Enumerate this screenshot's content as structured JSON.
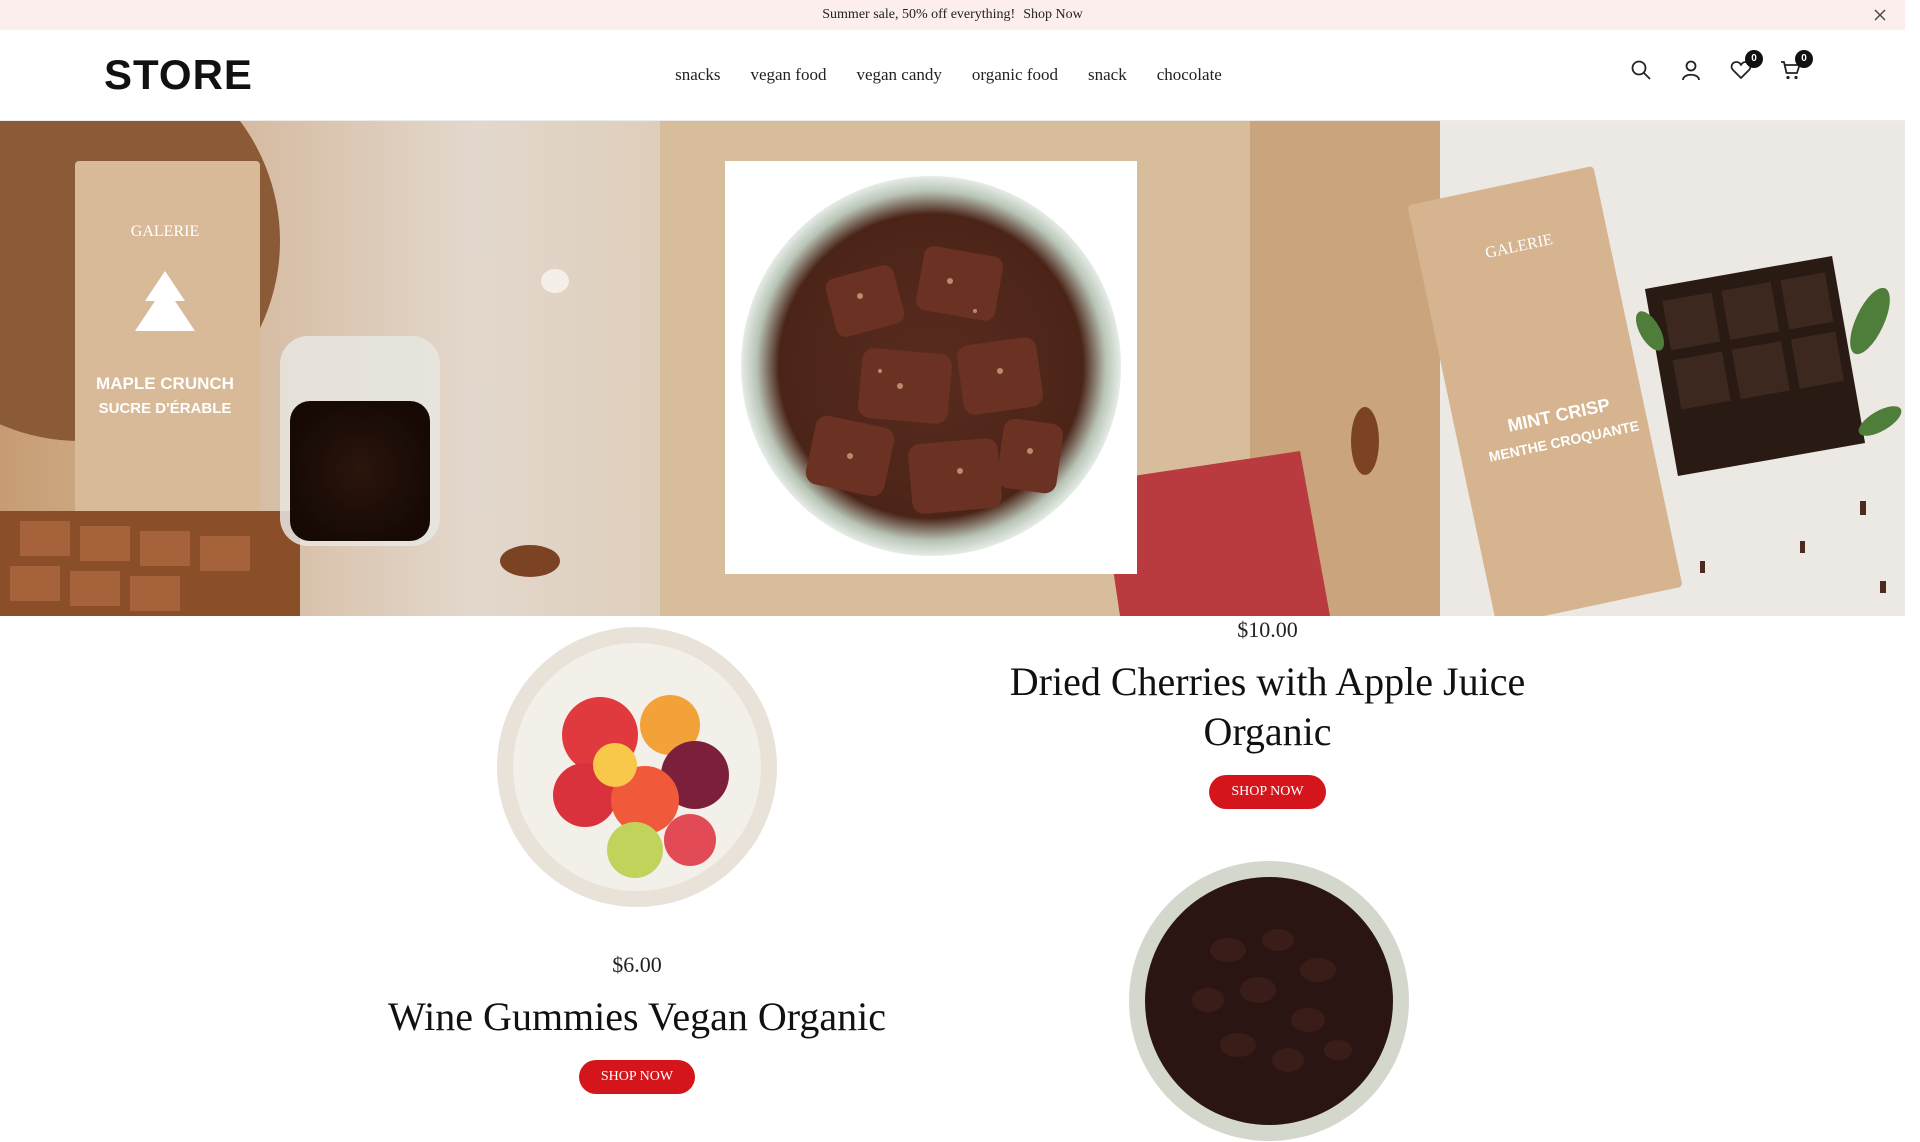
{
  "promo": {
    "text": "Summer sale, 50% off everything!",
    "link_label": "Shop Now"
  },
  "header": {
    "logo": "STORE",
    "nav": [
      "snacks",
      "vegan food",
      "vegan candy",
      "organic food",
      "snack",
      "chocolate"
    ],
    "icons": {
      "search": "search-icon",
      "account": "user-icon",
      "wishlist": "heart-icon",
      "cart": "cart-icon"
    },
    "wishlist_count": "0",
    "cart_count": "0"
  },
  "hero": {
    "panels": [
      "MAPLE CRUNCH",
      "SUCRE D'ÉRABLE",
      "MINT CRISP",
      "MENTHE CROQUANTE",
      "GALERIE"
    ]
  },
  "products": [
    {
      "price": "$10.00",
      "title": "Dried Cherries with Apple Juice Organic",
      "button": "SHOP NOW"
    },
    {
      "price": "$6.00",
      "title": "Wine Gummies Vegan Organic",
      "button": "SHOP NOW"
    }
  ],
  "colors": {
    "promo_bg": "#fdeeee",
    "accent": "#d4161c"
  }
}
